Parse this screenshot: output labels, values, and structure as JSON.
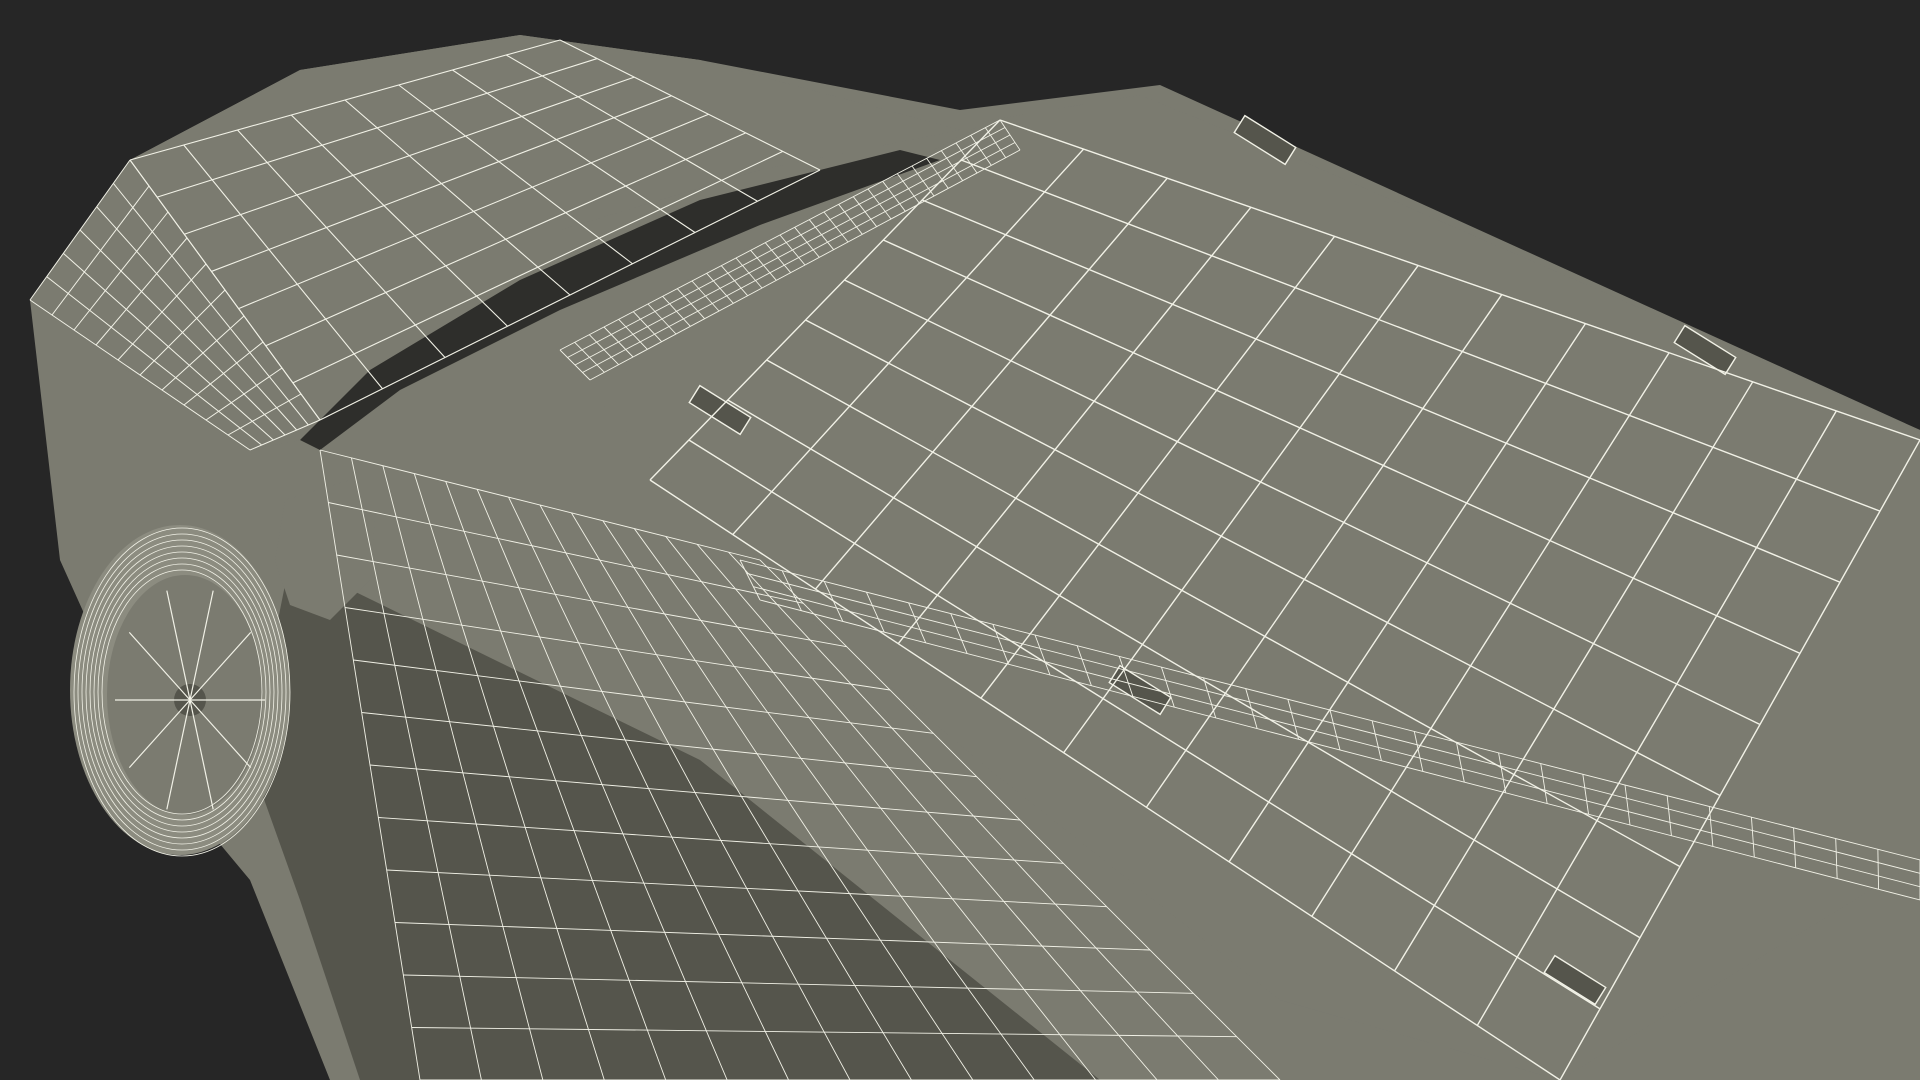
{
  "scene": {
    "subject": "vehicle-wireframe-render",
    "view": "rear-top-three-quarter",
    "colors": {
      "background": "#262626",
      "body": "#7b7b70",
      "body_shadow": "#55554c",
      "body_dark": "#2e2e2b",
      "wire": "#f1f1e6",
      "tire": "#8c8c80"
    }
  }
}
